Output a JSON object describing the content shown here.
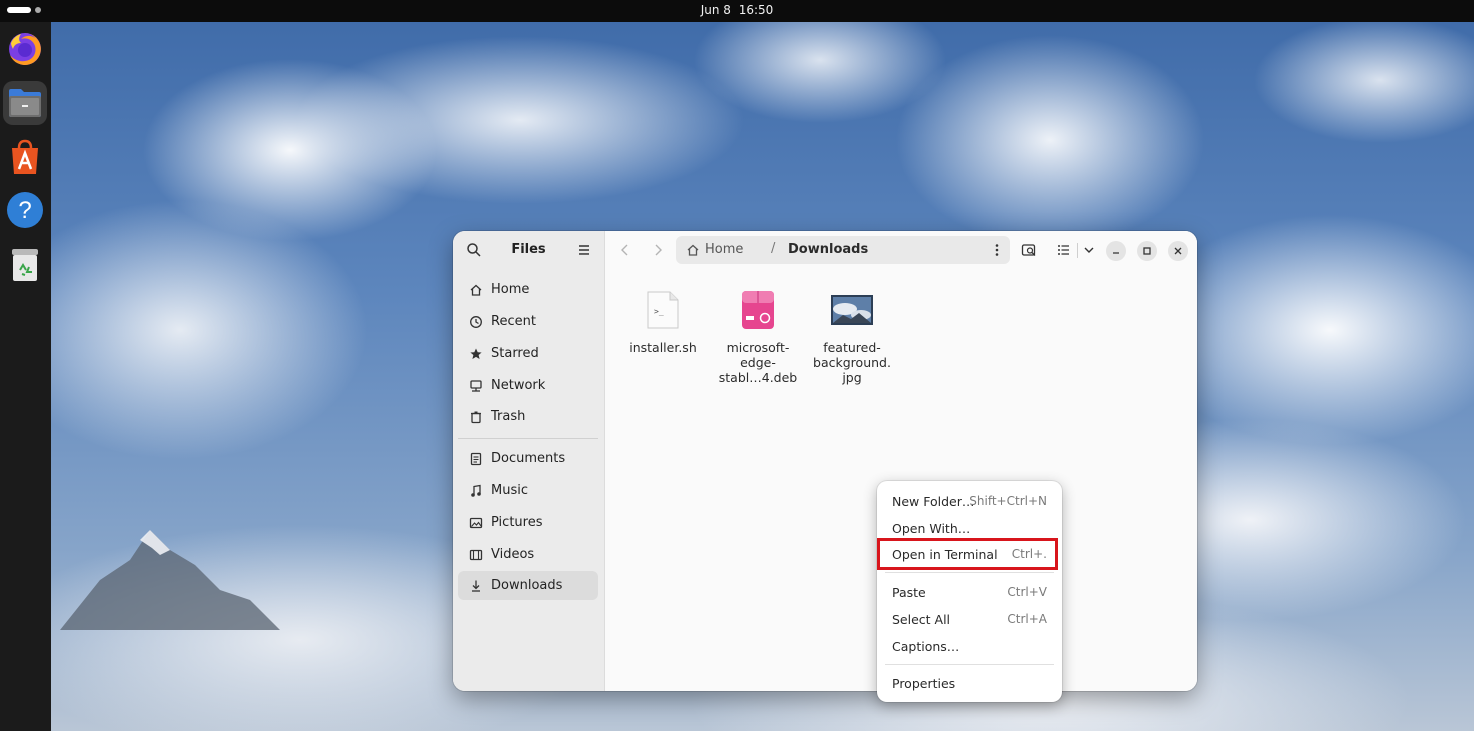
{
  "topbar": {
    "date": "Jun 8",
    "time": "16:50"
  },
  "dock": {
    "items": [
      {
        "name": "firefox",
        "icon": "firefox-icon"
      },
      {
        "name": "files",
        "icon": "files-icon"
      },
      {
        "name": "app-center",
        "icon": "app-center-icon"
      },
      {
        "name": "help",
        "icon": "help-icon"
      },
      {
        "name": "trash",
        "icon": "trash-icon"
      }
    ]
  },
  "sidebar": {
    "title": "Files",
    "places": [
      {
        "label": "Home",
        "icon": "home-icon"
      },
      {
        "label": "Recent",
        "icon": "recent-icon"
      },
      {
        "label": "Starred",
        "icon": "star-icon"
      },
      {
        "label": "Network",
        "icon": "network-icon"
      },
      {
        "label": "Trash",
        "icon": "trash-icon"
      }
    ],
    "bookmarks": [
      {
        "label": "Documents",
        "icon": "document-icon"
      },
      {
        "label": "Music",
        "icon": "music-icon"
      },
      {
        "label": "Pictures",
        "icon": "picture-icon"
      },
      {
        "label": "Videos",
        "icon": "video-icon"
      },
      {
        "label": "Downloads",
        "icon": "download-icon",
        "selected": true
      }
    ]
  },
  "pathbar": {
    "home": "Home",
    "separator": "/",
    "current": "Downloads"
  },
  "files": [
    {
      "name": "installer.sh",
      "icon": "script-file-icon"
    },
    {
      "name": "microsoft-\nedge-\nstabl…4.deb",
      "icon": "deb-package-icon"
    },
    {
      "name": "featured-\nbackground.\njpg",
      "icon": "image-thumbnail-icon"
    }
  ],
  "context_menu": {
    "items": [
      {
        "label": "New Folder…",
        "shortcut": "Shift+Ctrl+N"
      },
      {
        "label": "Open With…",
        "shortcut": ""
      },
      {
        "label": "Open in Terminal",
        "shortcut": "Ctrl+."
      },
      {
        "label": "Paste",
        "shortcut": "Ctrl+V"
      },
      {
        "label": "Select All",
        "shortcut": "Ctrl+A"
      },
      {
        "label": "Captions…",
        "shortcut": ""
      },
      {
        "label": "Properties",
        "shortcut": ""
      }
    ]
  },
  "colors": {
    "highlight_border": "#d8151c",
    "deb_icon": "#e6458f",
    "topbar": "#0c0c0c",
    "dock": "#1b1b1b"
  }
}
